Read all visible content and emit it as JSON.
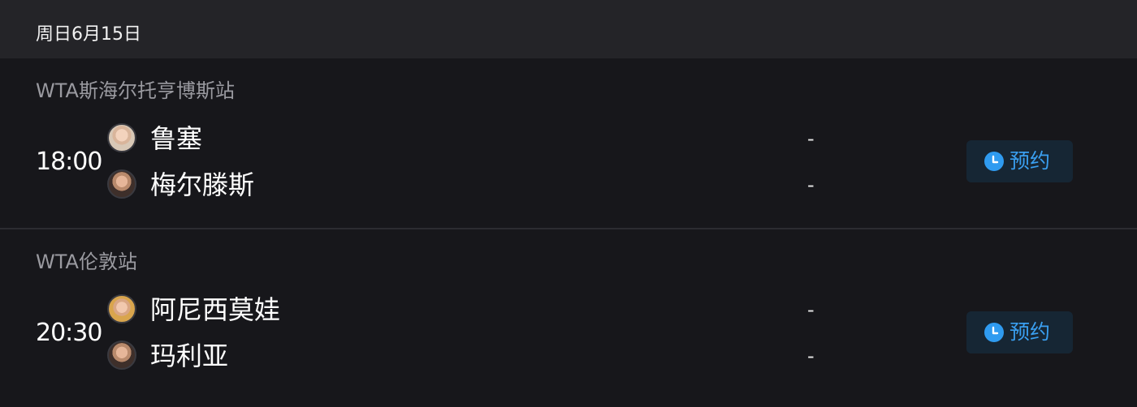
{
  "date_header": {
    "text": "周日6月15日"
  },
  "colors": {
    "background": "#17171b",
    "header_bg": "#242428",
    "accent": "#2f9bf0",
    "button_bg": "#162634"
  },
  "matches": [
    {
      "tournament": "WTA斯海尔托亨博斯站",
      "time": "18:00",
      "players": [
        {
          "name": "鲁塞",
          "avatar": "player-avatar",
          "score": "-"
        },
        {
          "name": "梅尔滕斯",
          "avatar": "player-avatar",
          "score": "-"
        }
      ],
      "button": {
        "label": "预约",
        "icon": "clock-icon"
      }
    },
    {
      "tournament": "WTA伦敦站",
      "time": "20:30",
      "players": [
        {
          "name": "阿尼西莫娃",
          "avatar": "player-avatar",
          "score": "-"
        },
        {
          "name": "玛利亚",
          "avatar": "player-avatar",
          "score": "-"
        }
      ],
      "button": {
        "label": "预约",
        "icon": "clock-icon"
      }
    }
  ]
}
